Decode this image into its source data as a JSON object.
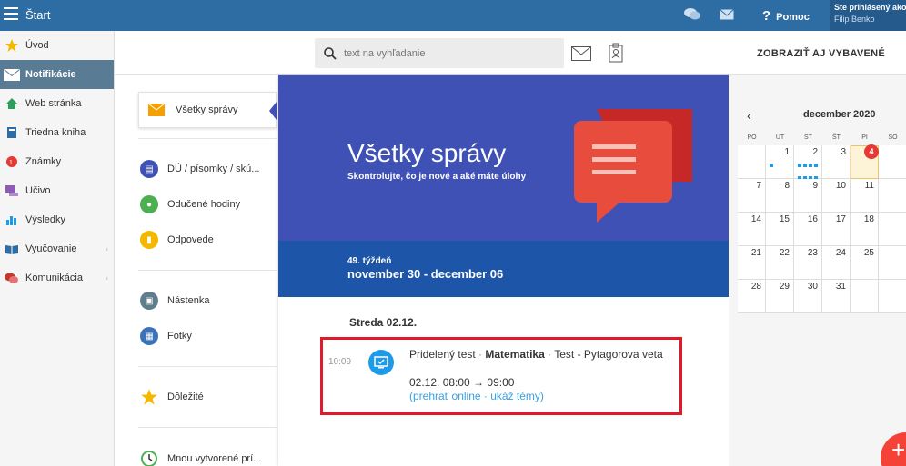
{
  "app": {
    "title": "Štart"
  },
  "topbar": {
    "help_label": "Pomoc",
    "user_line1": "Ste prihlásený ako",
    "user_line2": "Filip Benko"
  },
  "sidebar": {
    "items": [
      {
        "label": "Úvod",
        "icon": "star-icon"
      },
      {
        "label": "Notifikácie",
        "icon": "envelope-icon",
        "active": true
      },
      {
        "label": "Web stránka",
        "icon": "home-icon"
      },
      {
        "label": "Triedna kniha",
        "icon": "book-icon"
      },
      {
        "label": "Známky",
        "icon": "grades-icon"
      },
      {
        "label": "Učivo",
        "icon": "curriculum-icon"
      },
      {
        "label": "Výsledky",
        "icon": "bar-chart-icon"
      },
      {
        "label": "Vyučovanie",
        "icon": "open-book-icon",
        "has_submenu": true
      },
      {
        "label": "Komunikácia",
        "icon": "chat-icon",
        "has_submenu": true
      }
    ]
  },
  "toolbar": {
    "search_placeholder": "text na vyhľadanie",
    "show_all_label": "ZOBRAZIŤ AJ VYBAVENÉ"
  },
  "filters": {
    "active": "Všetky správy",
    "items": [
      {
        "label": "DÚ / písomky / skú...",
        "color": "#3f51b5"
      },
      {
        "label": "Odučené hodiny",
        "color": "#4caf50"
      },
      {
        "label": "Odpovede",
        "color": "#f5b800"
      },
      {
        "label": "Nástenka",
        "color": "#607d8b"
      },
      {
        "label": "Fotky",
        "color": "#3b73b9"
      },
      {
        "label": "Dôležité",
        "color": "#f5b800"
      },
      {
        "label": "Mnou vytvorené prí...",
        "color": "#4caf50"
      }
    ]
  },
  "hero": {
    "title": "Všetky správy",
    "subtitle": "Skontrolujte, čo je nové a aké máte úlohy",
    "accent": "#3f51b5"
  },
  "week": {
    "label": "49. týždeň",
    "range": "november 30 - december 06"
  },
  "day": {
    "header": "Streda 02.12.",
    "events": [
      {
        "time": "10:09",
        "type_label": "Pridelený test",
        "subject": "Matematika",
        "title": "Test - Pytagorova veta",
        "schedule": "02.12. 08:00 → 09:00",
        "action_play": "(prehrať online",
        "action_topics": "ukáž témy)"
      }
    ]
  },
  "calendar": {
    "month_label": "december 2020",
    "weekdays": [
      "PO",
      "UT",
      "ST",
      "ŠT",
      "PI",
      "SO"
    ],
    "today": "4",
    "weeks": [
      [
        "",
        "1",
        "2",
        "3",
        "4",
        ""
      ],
      [
        "7",
        "8",
        "9",
        "10",
        "11",
        ""
      ],
      [
        "14",
        "15",
        "16",
        "17",
        "18",
        ""
      ],
      [
        "21",
        "22",
        "23",
        "24",
        "25",
        ""
      ],
      [
        "28",
        "29",
        "30",
        "31",
        "",
        ""
      ]
    ]
  },
  "fab": {
    "label": "+"
  }
}
